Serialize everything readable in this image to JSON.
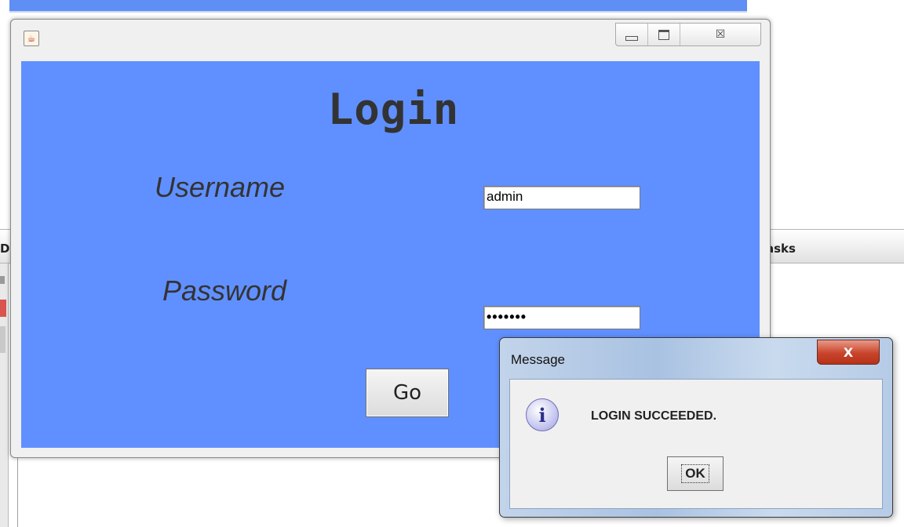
{
  "background": {
    "tab_header_label": "asks",
    "left_header_label": "D"
  },
  "login_window": {
    "icons": {
      "app": "java-icon",
      "minimize": "minimize-icon",
      "maximize": "maximize-icon",
      "close": "close-icon"
    },
    "close_glyph": "☒",
    "title": "Login",
    "username_label": "Username",
    "username_value": "admin",
    "password_label": "Password",
    "password_mask": "•••••••",
    "go_button": "Go",
    "content_color": "#6090ff"
  },
  "message_dialog": {
    "title": "Message",
    "close_glyph": "X",
    "icon": "info-icon",
    "icon_glyph": "i",
    "message": "LOGIN SUCCEEDED.",
    "ok_button": "OK"
  }
}
